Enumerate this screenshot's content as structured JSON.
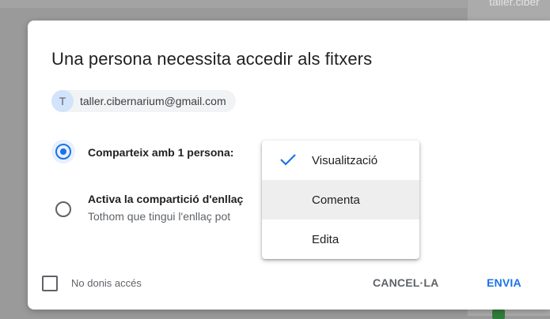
{
  "background": {
    "right_panel_text": "taller.ciber"
  },
  "dialog": {
    "title": "Una persona necessita accedir als fitxers",
    "recipient": {
      "avatar_letter": "T",
      "email": "taller.cibernarium@gmail.com"
    },
    "options": [
      {
        "label": "Comparteix amb 1 persona:",
        "selected": true
      },
      {
        "label": "Activa la compartició d'enllaç",
        "sublabel": "Tothom que tingui l'enllaç pot",
        "selected": false
      }
    ],
    "footer": {
      "checkbox_label": "No donis accés",
      "checkbox_checked": false,
      "cancel_label": "CANCEL·LA",
      "send_label": "ENVIA"
    }
  },
  "permission_menu": {
    "items": [
      {
        "label": "Visualització",
        "checked": true
      },
      {
        "label": "Comenta",
        "highlighted": true
      },
      {
        "label": "Edita"
      }
    ]
  },
  "colors": {
    "accent": "#1a73e8",
    "overlay": "#9a9a9a"
  }
}
